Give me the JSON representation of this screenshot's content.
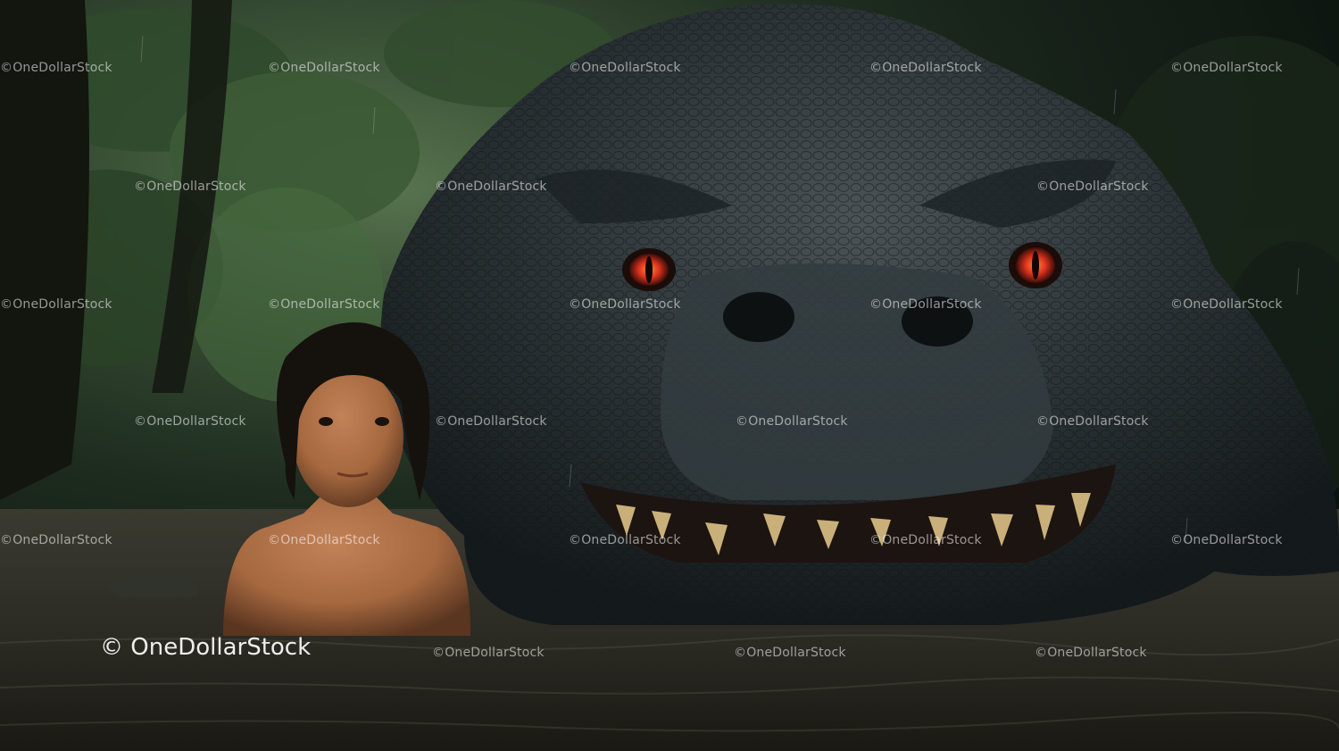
{
  "image": {
    "alt": "",
    "watermark_small": "©OneDollarStock",
    "watermark_main": "© OneDollarStock"
  },
  "colors": {
    "foliage": "#2f4a2c",
    "water": "#3b3a30",
    "creature_skin": "#2a3134",
    "eye": "#e0341e",
    "child_skin": "#a5683f",
    "hair": "#15110d"
  }
}
